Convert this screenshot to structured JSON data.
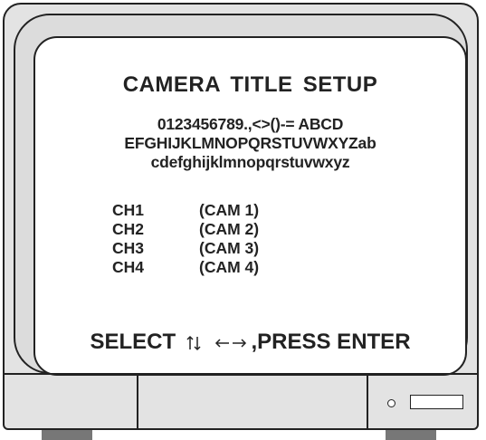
{
  "osd": {
    "title": "CAMERA TITLE  SETUP",
    "charset": [
      "0123456789.,<>()-= ABCD",
      "EFGHIJKLMNOPQRSTUVWXYZab",
      "cdefghijklmnopqrstuvwxyz"
    ],
    "channels": [
      {
        "label": "CH1",
        "title": "(CAM  1)"
      },
      {
        "label": "CH2",
        "title": "(CAM  2)"
      },
      {
        "label": "CH3",
        "title": "(CAM  3)"
      },
      {
        "label": "CH4",
        "title": "(CAM  4)"
      }
    ],
    "footer_select": "SELECT",
    "footer_press": ",PRESS  ENTER"
  },
  "icons": {
    "up_down_arrows": "up-down-arrows-icon",
    "left_right_arrows": "left-right-arrows-icon",
    "power_led": "power-led-icon"
  }
}
